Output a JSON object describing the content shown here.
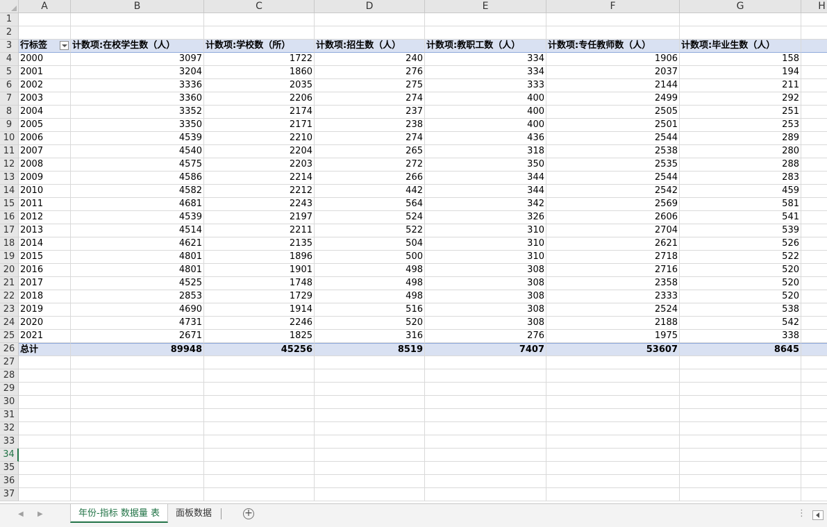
{
  "columns": [
    "A",
    "B",
    "C",
    "D",
    "E",
    "F",
    "G",
    "H"
  ],
  "row_numbers": [
    "1",
    "2",
    "3",
    "4",
    "5",
    "6",
    "7",
    "8",
    "9",
    "10",
    "11",
    "12",
    "13",
    "14",
    "15",
    "16",
    "17",
    "18",
    "19",
    "20",
    "21",
    "22",
    "23",
    "24",
    "25",
    "26",
    "27",
    "28",
    "29",
    "30",
    "31",
    "32",
    "33",
    "34",
    "35",
    "36",
    "37"
  ],
  "active_row": "34",
  "pivot": {
    "row_label": "行标签",
    "headers": [
      "计数项:在校学生数（人）",
      "计数项:学校数（所）",
      "计数项:招生数（人）",
      "计数项:教职工数（人）",
      "计数项:专任教师数（人）",
      "计数项:毕业生数（人）"
    ],
    "rows": [
      {
        "year": "2000",
        "values": [
          "3097",
          "1722",
          "240",
          "334",
          "1906",
          "158"
        ]
      },
      {
        "year": "2001",
        "values": [
          "3204",
          "1860",
          "276",
          "334",
          "2037",
          "194"
        ]
      },
      {
        "year": "2002",
        "values": [
          "3336",
          "2035",
          "275",
          "333",
          "2144",
          "211"
        ]
      },
      {
        "year": "2003",
        "values": [
          "3360",
          "2206",
          "274",
          "400",
          "2499",
          "292"
        ]
      },
      {
        "year": "2004",
        "values": [
          "3352",
          "2174",
          "237",
          "400",
          "2505",
          "251"
        ]
      },
      {
        "year": "2005",
        "values": [
          "3350",
          "2171",
          "238",
          "400",
          "2501",
          "253"
        ]
      },
      {
        "year": "2006",
        "values": [
          "4539",
          "2210",
          "274",
          "436",
          "2544",
          "289"
        ]
      },
      {
        "year": "2007",
        "values": [
          "4540",
          "2204",
          "265",
          "318",
          "2538",
          "280"
        ]
      },
      {
        "year": "2008",
        "values": [
          "4575",
          "2203",
          "272",
          "350",
          "2535",
          "288"
        ]
      },
      {
        "year": "2009",
        "values": [
          "4586",
          "2214",
          "266",
          "344",
          "2544",
          "283"
        ]
      },
      {
        "year": "2010",
        "values": [
          "4582",
          "2212",
          "442",
          "344",
          "2542",
          "459"
        ]
      },
      {
        "year": "2011",
        "values": [
          "4681",
          "2243",
          "564",
          "342",
          "2569",
          "581"
        ]
      },
      {
        "year": "2012",
        "values": [
          "4539",
          "2197",
          "524",
          "326",
          "2606",
          "541"
        ]
      },
      {
        "year": "2013",
        "values": [
          "4514",
          "2211",
          "522",
          "310",
          "2704",
          "539"
        ]
      },
      {
        "year": "2014",
        "values": [
          "4621",
          "2135",
          "504",
          "310",
          "2621",
          "526"
        ]
      },
      {
        "year": "2015",
        "values": [
          "4801",
          "1896",
          "500",
          "310",
          "2718",
          "522"
        ]
      },
      {
        "year": "2016",
        "values": [
          "4801",
          "1901",
          "498",
          "308",
          "2716",
          "520"
        ]
      },
      {
        "year": "2017",
        "values": [
          "4525",
          "1748",
          "498",
          "308",
          "2358",
          "520"
        ]
      },
      {
        "year": "2018",
        "values": [
          "2853",
          "1729",
          "498",
          "308",
          "2333",
          "520"
        ]
      },
      {
        "year": "2019",
        "values": [
          "4690",
          "1914",
          "516",
          "308",
          "2524",
          "538"
        ]
      },
      {
        "year": "2020",
        "values": [
          "4731",
          "2246",
          "520",
          "308",
          "2188",
          "542"
        ]
      },
      {
        "year": "2021",
        "values": [
          "2671",
          "1825",
          "316",
          "276",
          "1975",
          "338"
        ]
      }
    ],
    "total_label": "总计",
    "totals": [
      "89948",
      "45256",
      "8519",
      "7407",
      "53607",
      "8645"
    ]
  },
  "sheet_tabs": [
    {
      "label": "年份-指标 数据量 表",
      "active": true
    },
    {
      "label": "面板数据",
      "active": false
    }
  ],
  "add_sheet_symbol": "+",
  "colors": {
    "accent": "#217346",
    "pivot_band": "#d9e1f2"
  }
}
